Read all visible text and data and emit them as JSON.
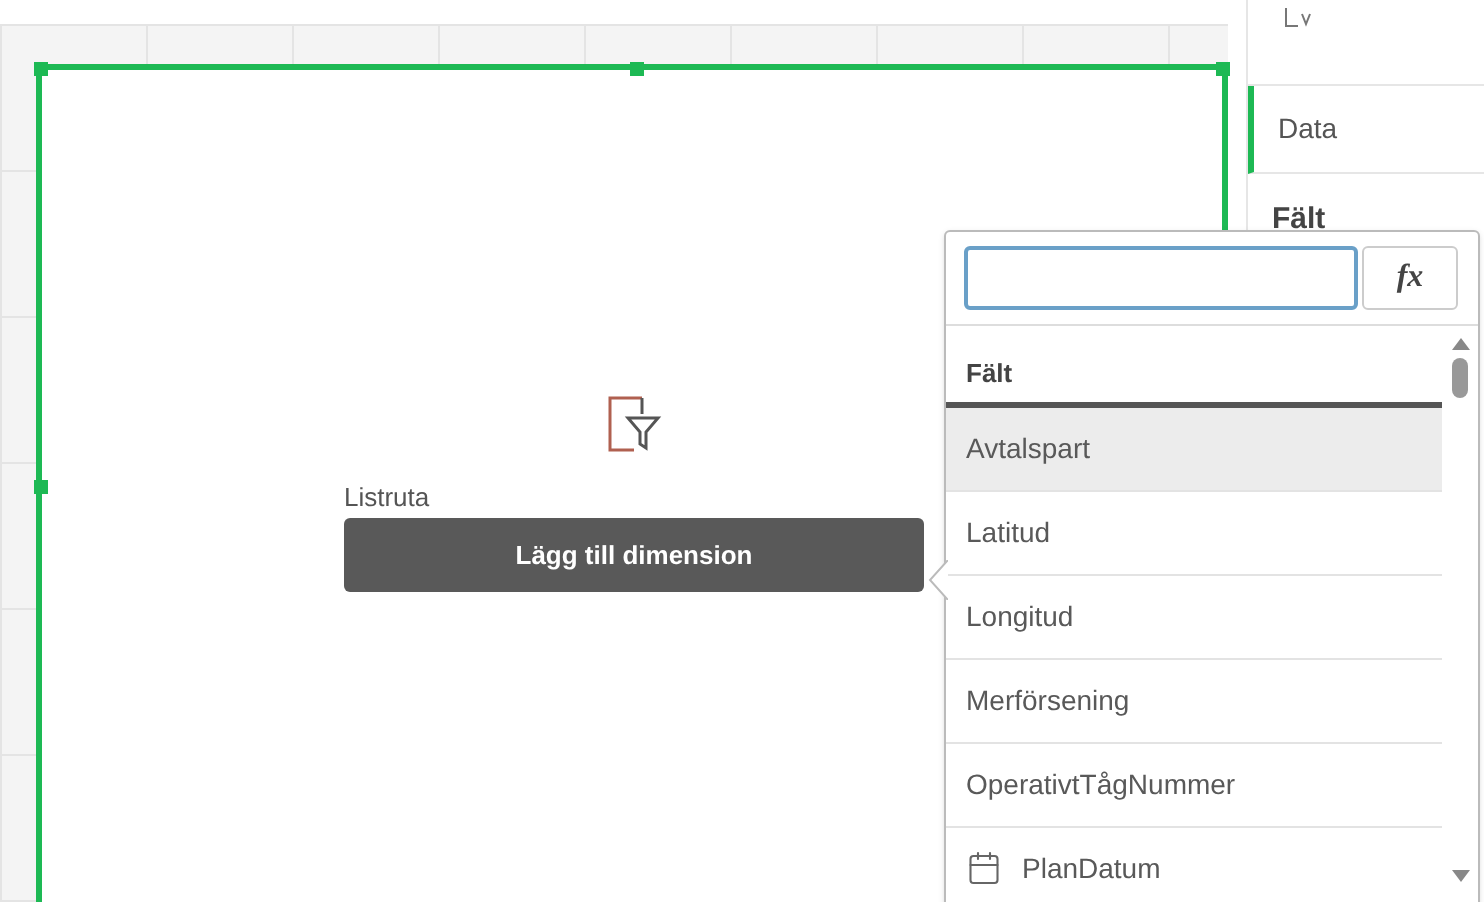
{
  "panel": {
    "tabs": [
      {
        "label": "Data",
        "selected": true
      }
    ],
    "section_title": "Fält"
  },
  "listbox": {
    "label": "Listruta",
    "button": "Lägg till dimension"
  },
  "field_picker": {
    "expression_button": "fx",
    "section_title": "Fält",
    "items": [
      {
        "label": "Avtalspart",
        "kind": "text",
        "selected": true
      },
      {
        "label": "Latitud",
        "kind": "text",
        "selected": false
      },
      {
        "label": "Longitud",
        "kind": "text",
        "selected": false
      },
      {
        "label": "Merförsening",
        "kind": "text",
        "selected": false
      },
      {
        "label": "OperativtTågNummer",
        "kind": "text",
        "selected": false
      },
      {
        "label": "PlanDatum",
        "kind": "date",
        "selected": false
      }
    ]
  }
}
